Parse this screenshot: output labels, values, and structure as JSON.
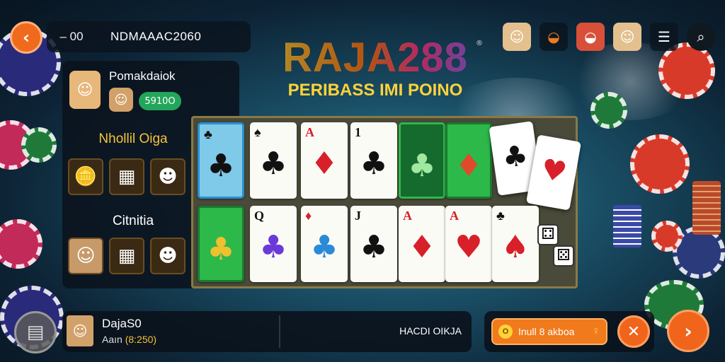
{
  "topbar": {
    "back_icon": "back-arrow-icon",
    "number": "– 00",
    "username": "NDMAAAC2060"
  },
  "logo": {
    "main": "RAJA288",
    "sub": "PERIBASS IMI POINO",
    "reg": "®"
  },
  "top_icons": [
    "avatar-icon",
    "basket-icon",
    "basket-icon",
    "avatar-icon",
    "menu-icon",
    "search-icon"
  ],
  "left_panel": {
    "title": "Pomakdaiok",
    "score": "5910O",
    "section1": "Nhollil Oiga",
    "section2": "Citnitia"
  },
  "bottom": {
    "player_name": "DajaS0",
    "player_sub_label": "Aaın",
    "player_amount": "(8:250)",
    "right_text": "HACDI OIKJA",
    "bet_label": "Inull 8 akboa",
    "bet_coin": "O"
  },
  "colors": {
    "accent": "#f06a1d",
    "gold": "#f6c23a",
    "green": "#23a65a",
    "panel": "#0a121c"
  }
}
